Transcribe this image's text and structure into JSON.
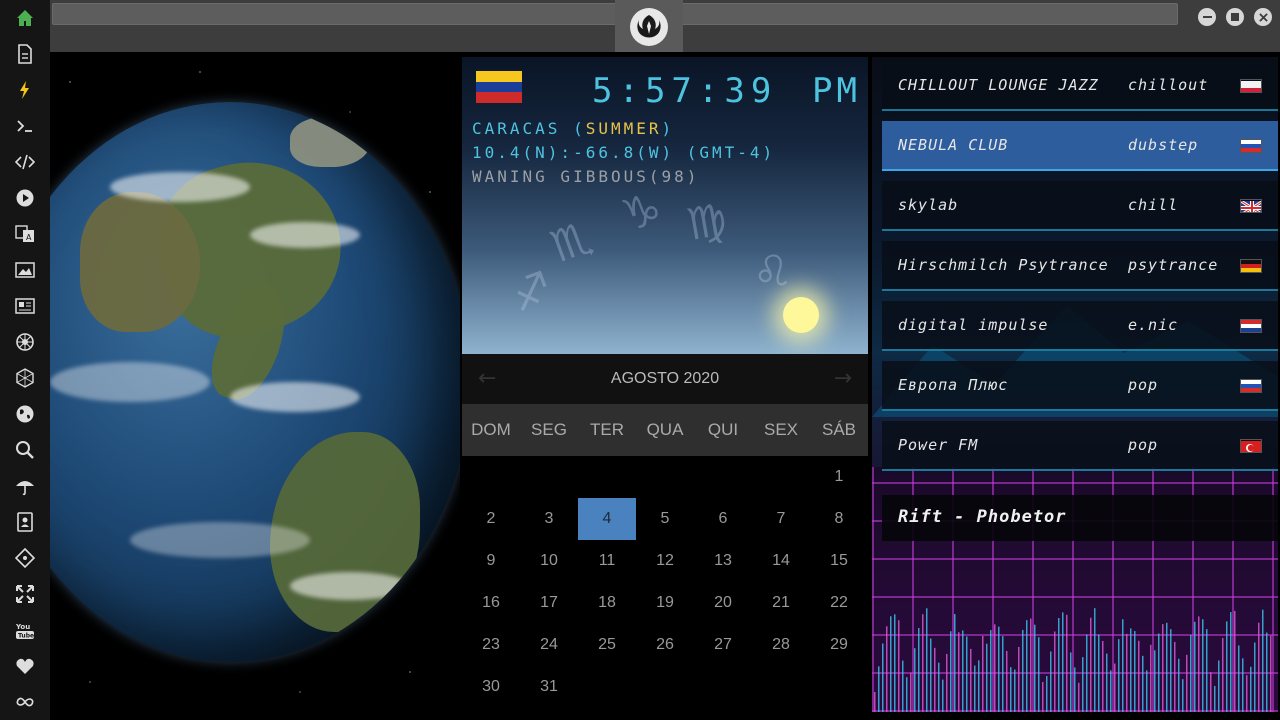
{
  "sidebar": {
    "items": [
      {
        "icon": "home-icon",
        "active": true
      },
      {
        "icon": "document-icon"
      },
      {
        "icon": "bolt-icon",
        "accent": true
      },
      {
        "icon": "terminal-icon"
      },
      {
        "icon": "code-icon"
      },
      {
        "icon": "play-icon"
      },
      {
        "icon": "translate-icon"
      },
      {
        "icon": "image-icon"
      },
      {
        "icon": "news-icon"
      },
      {
        "icon": "rebel-icon"
      },
      {
        "icon": "hexagon-icon"
      },
      {
        "icon": "globe-icon"
      },
      {
        "icon": "search-icon"
      },
      {
        "icon": "umbrella-icon"
      },
      {
        "icon": "contacts-icon"
      },
      {
        "icon": "tag-icon"
      },
      {
        "icon": "fullscreen-icon"
      },
      {
        "icon": "youtube-icon"
      },
      {
        "icon": "heart-icon"
      },
      {
        "icon": "infinity-icon"
      }
    ],
    "accent_color": "#4caf50",
    "bolt_color": "#f5c518"
  },
  "clock": {
    "time": "5:57:39",
    "ampm": "PM",
    "location": "CARACAS",
    "season": "SUMMER",
    "coords": "10.4(N):-66.8(W) (GMT-4)",
    "moon": "WANING GIBBOUS(98)",
    "colors": {
      "digits": "#4ec3e0",
      "season": "#e6c44a",
      "moon": "#9aa0a6"
    }
  },
  "calendar": {
    "title": "AGOSTO 2020",
    "days_of_week": [
      "DOM",
      "SEG",
      "TER",
      "QUA",
      "QUI",
      "SEX",
      "SÁB"
    ],
    "weeks": [
      [
        "",
        "",
        "",
        "",
        "",
        "",
        "1"
      ],
      [
        "2",
        "3",
        "4",
        "5",
        "6",
        "7",
        "8"
      ],
      [
        "9",
        "10",
        "11",
        "12",
        "13",
        "14",
        "15"
      ],
      [
        "16",
        "17",
        "18",
        "19",
        "20",
        "21",
        "22"
      ],
      [
        "23",
        "24",
        "25",
        "26",
        "27",
        "28",
        "29"
      ],
      [
        "30",
        "31",
        "",
        "",
        "",
        "",
        ""
      ]
    ],
    "today": "4"
  },
  "radio": {
    "stations": [
      {
        "name": "CHILLOUT LOUNGE JAZZ",
        "genre": "chillout",
        "country": "pl",
        "active": false
      },
      {
        "name": "NEBULA CLUB",
        "genre": "dubstep",
        "country": "ru",
        "active": true
      },
      {
        "name": "skylab",
        "genre": "chill",
        "country": "gb",
        "active": false
      },
      {
        "name": "Hirschmilch Psytrance",
        "genre": "psytrance",
        "country": "de",
        "active": false
      },
      {
        "name": "digital impulse",
        "genre": "e.nic",
        "country": "hr",
        "active": false
      },
      {
        "name": "Европа Плюс",
        "genre": "pop",
        "country": "ru",
        "active": false
      },
      {
        "name": "Power FM",
        "genre": "pop",
        "country": "tr",
        "active": false
      }
    ],
    "now_playing": "Rift - Phobetor"
  }
}
